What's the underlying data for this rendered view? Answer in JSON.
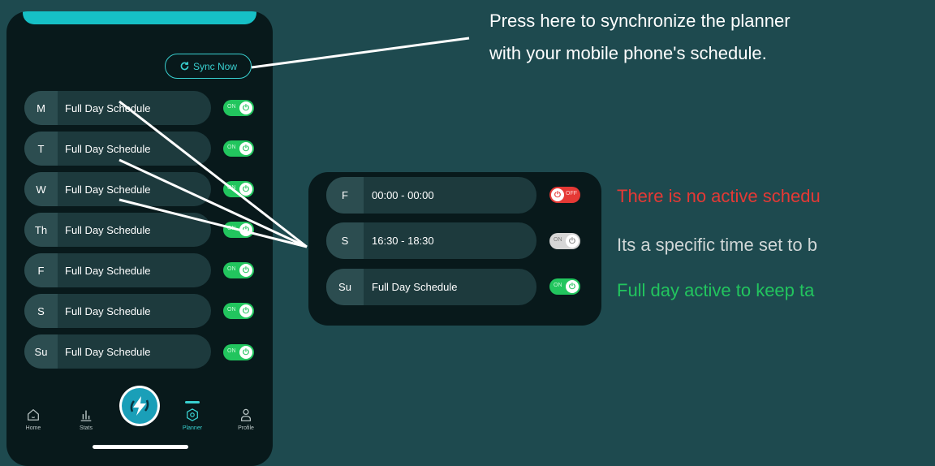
{
  "colors": {
    "background": "#1e4a4f",
    "phone": "#08191b",
    "accent": "#39d0d0",
    "toggle_on": "#22c55e",
    "toggle_off": "#e53935",
    "toggle_idle": "#d6d6d6",
    "legend_red": "#e53935",
    "legend_gray": "#cfd6d6",
    "legend_green": "#22c55e"
  },
  "sync": {
    "label": "Sync Now",
    "icon": "refresh-icon"
  },
  "schedule": [
    {
      "day": "M",
      "label": "Full Day Schedule",
      "toggle": "ON"
    },
    {
      "day": "T",
      "label": "Full Day Schedule",
      "toggle": "ON"
    },
    {
      "day": "W",
      "label": "Full Day Schedule",
      "toggle": "ON"
    },
    {
      "day": "Th",
      "label": "Full Day Schedule",
      "toggle": "ON"
    },
    {
      "day": "F",
      "label": "Full Day Schedule",
      "toggle": "ON"
    },
    {
      "day": "S",
      "label": "Full Day Schedule",
      "toggle": "ON"
    },
    {
      "day": "Su",
      "label": "Full Day Schedule",
      "toggle": "ON"
    }
  ],
  "tabs": [
    {
      "label": "Home",
      "icon": "home-icon"
    },
    {
      "label": "Stats",
      "icon": "stats-icon"
    },
    {
      "label": "Planner",
      "icon": "planner-icon"
    },
    {
      "label": "Profile",
      "icon": "profile-icon"
    }
  ],
  "fab": {
    "icon": "bolt-icon"
  },
  "zoom": [
    {
      "day": "F",
      "label": "00:00 - 00:00",
      "toggle": "OFF"
    },
    {
      "day": "S",
      "label": "16:30 - 18:30",
      "toggle": "ON"
    },
    {
      "day": "Su",
      "label": "Full Day Schedule",
      "toggle": "ON"
    }
  ],
  "callout": {
    "line1": "Press here to synchronize the planner",
    "line2": "with your mobile phone's schedule."
  },
  "legend": {
    "off": "There is no active schedu",
    "specific": "Its a specific time set to b",
    "full": "Full day active to keep ta"
  }
}
